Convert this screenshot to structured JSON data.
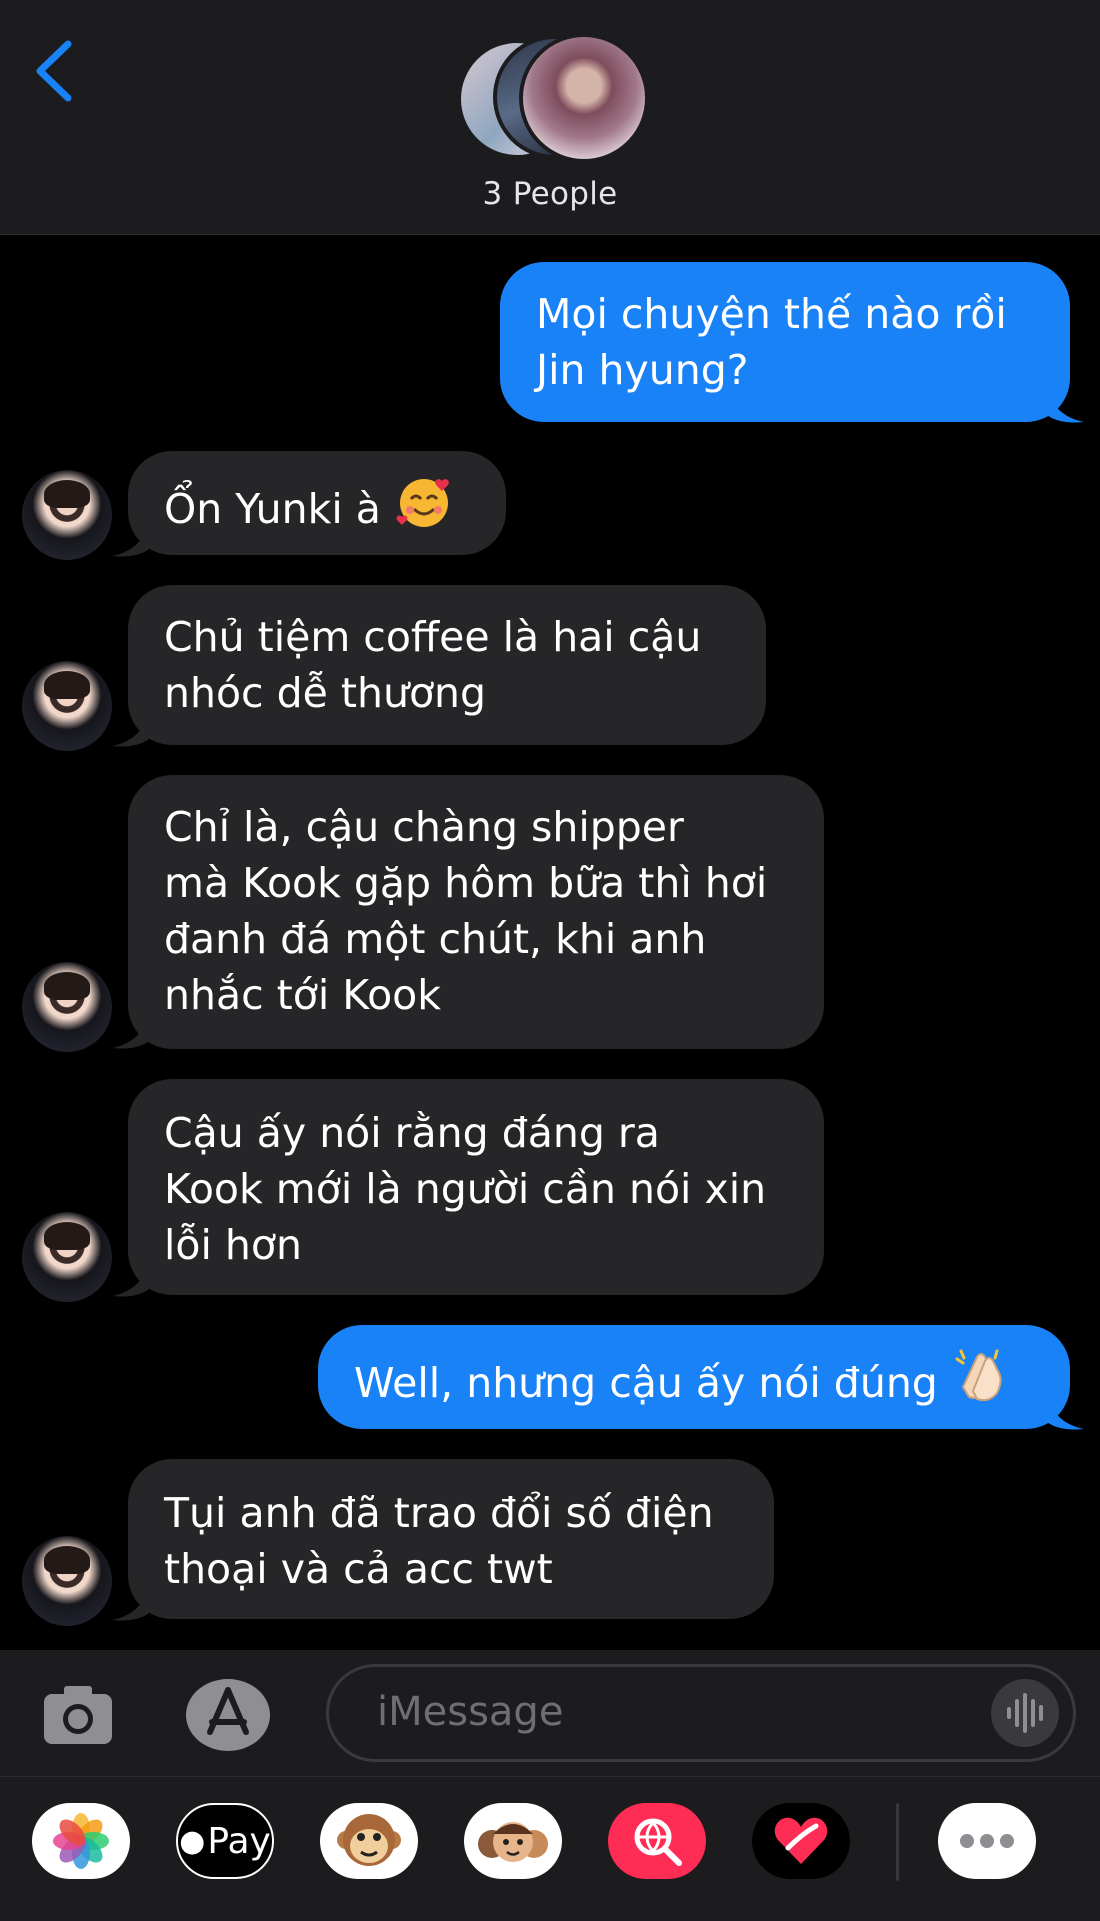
{
  "header": {
    "participants": "3 People"
  },
  "messages": [
    {
      "dir": "out",
      "lines": [
        "Mọi chuyện thế nào rồi",
        "Jin hyung?"
      ]
    },
    {
      "dir": "in",
      "lines": [
        "Ổn Yunki à"
      ],
      "emoji": "smiling-face-with-hearts"
    },
    {
      "dir": "in",
      "lines": [
        "Chủ tiệm coffee là hai cậu",
        "nhóc dễ thương"
      ]
    },
    {
      "dir": "in",
      "lines": [
        "Chỉ là, cậu chàng shipper",
        "mà Kook gặp hôm bữa thì hơi",
        "đanh đá một chút, khi anh",
        "nhắc tới Kook"
      ]
    },
    {
      "dir": "in",
      "lines": [
        "Cậu ấy nói rằng đáng ra",
        "Kook mới là người cần nói xin",
        "lỗi hơn"
      ]
    },
    {
      "dir": "out",
      "lines": [
        "Well, nhưng cậu ấy nói đúng"
      ],
      "emoji": "clapping-hands"
    },
    {
      "dir": "in",
      "lines": [
        "Tụi anh đã trao đổi số điện",
        "thoại và cả acc twt"
      ]
    }
  ],
  "input": {
    "placeholder": "iMessage"
  },
  "app_strip": {
    "apple_pay_label": "Pay",
    "icons": [
      "photos-icon",
      "apple-pay-icon",
      "monkey-animoji-icon",
      "memoji-icon",
      "image-search-icon",
      "digital-touch-icon",
      "more-icon"
    ]
  },
  "colors": {
    "outgoing_bubble": "#1a82f7",
    "incoming_bubble": "#262628",
    "header_bg": "#1c1c1e",
    "accent": "#1a82f7"
  }
}
